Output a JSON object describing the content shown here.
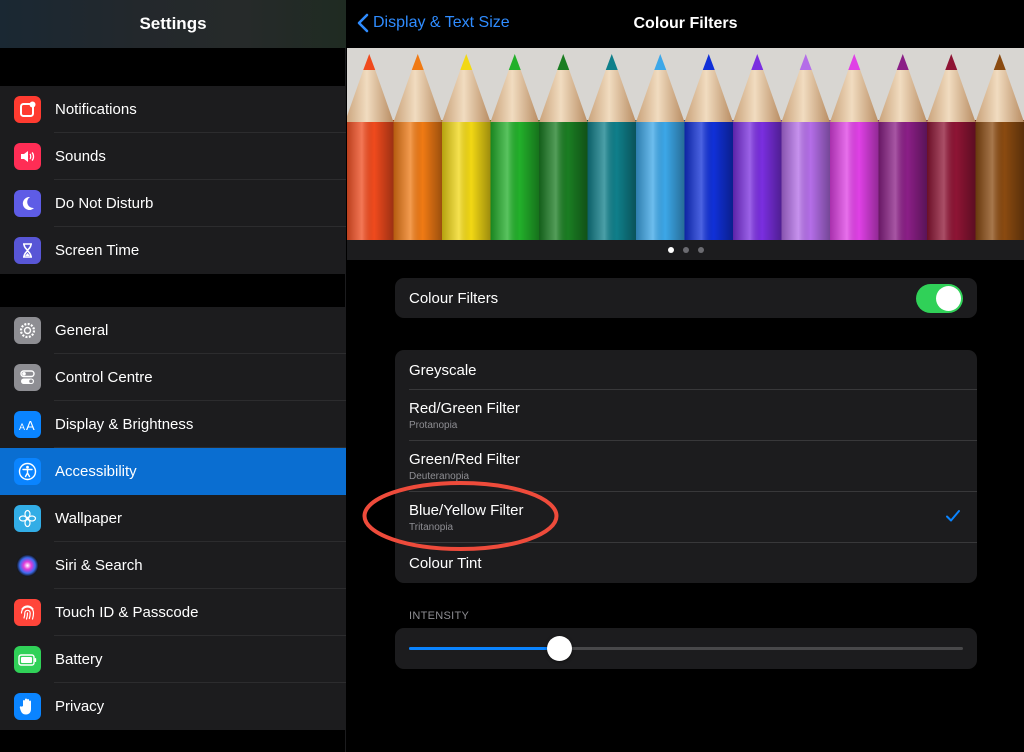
{
  "sidebar": {
    "title": "Settings",
    "group1": [
      {
        "label": "Notifications",
        "icon": "notifications-icon",
        "color": "#ff3b30"
      },
      {
        "label": "Sounds",
        "icon": "speaker-icon",
        "color": "#ff2d55"
      },
      {
        "label": "Do Not Disturb",
        "icon": "moon-icon",
        "color": "#5e5ce6"
      },
      {
        "label": "Screen Time",
        "icon": "hourglass-icon",
        "color": "#5856d6"
      }
    ],
    "group2": [
      {
        "label": "General",
        "icon": "gear-icon",
        "color": "#8e8e93"
      },
      {
        "label": "Control Centre",
        "icon": "toggles-icon",
        "color": "#8e8e93"
      },
      {
        "label": "Display & Brightness",
        "icon": "text-size-icon",
        "color": "#0a84ff"
      },
      {
        "label": "Accessibility",
        "icon": "accessibility-icon",
        "color": "#0a84ff",
        "selected": true
      },
      {
        "label": "Wallpaper",
        "icon": "flower-icon",
        "color": "#32ade6"
      },
      {
        "label": "Siri & Search",
        "icon": "siri-icon",
        "color": "#1c1c1e"
      },
      {
        "label": "Touch ID & Passcode",
        "icon": "fingerprint-icon",
        "color": "#ff453a"
      },
      {
        "label": "Battery",
        "icon": "battery-icon",
        "color": "#30d158"
      },
      {
        "label": "Privacy",
        "icon": "hand-icon",
        "color": "#0a84ff"
      }
    ]
  },
  "nav": {
    "back_label": "Display & Text Size",
    "title": "Colour Filters"
  },
  "carousel": {
    "pencil_colors": [
      "#f04a1d",
      "#f07a14",
      "#f2d814",
      "#22b02a",
      "#1a7d22",
      "#0f7f8a",
      "#3ca7e8",
      "#1030d8",
      "#7a2ee0",
      "#b46ee8",
      "#e040e6",
      "#8a1e86",
      "#8e1434",
      "#8a4a10"
    ],
    "page_count": 3,
    "active_page": 0
  },
  "toggle_row": {
    "label": "Colour Filters",
    "enabled": true
  },
  "filters": {
    "options": [
      {
        "title": "Greyscale",
        "subtitle": ""
      },
      {
        "title": "Red/Green Filter",
        "subtitle": "Protanopia"
      },
      {
        "title": "Green/Red Filter",
        "subtitle": "Deuteranopia"
      },
      {
        "title": "Blue/Yellow Filter",
        "subtitle": "Tritanopia",
        "selected": true
      },
      {
        "title": "Colour Tint",
        "subtitle": ""
      }
    ]
  },
  "intensity": {
    "label": "INTENSITY",
    "value": 0.27
  },
  "colors": {
    "accent": "#0a84ff",
    "toggle_on": "#30d158",
    "annotation": "#ee4b3b"
  }
}
